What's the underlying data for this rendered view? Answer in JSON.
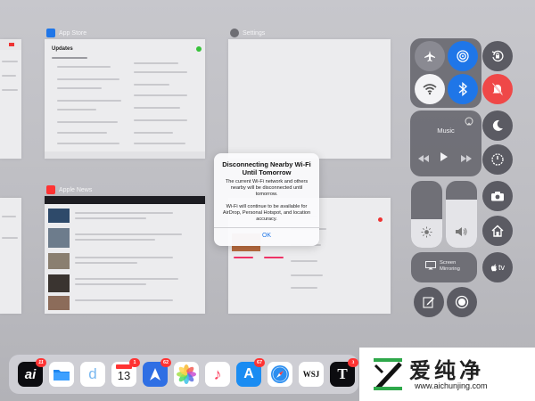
{
  "app_switcher": {
    "app_store_label": "App Store",
    "settings_label": "Settings",
    "news_label": "Apple News",
    "updates_title": "Updates"
  },
  "control_center": {
    "music_label": "Music",
    "screen_mirroring_label": "Screen Mirroring",
    "appletv_label": "tv"
  },
  "alert": {
    "title": "Disconnecting Nearby Wi-Fi Until Tomorrow",
    "message1": "The current Wi-Fi network and others nearby will be disconnected until tomorrow.",
    "message2": "Wi-Fi will continue to be available for AirDrop, Personal Hotspot, and location accuracy.",
    "ok": "OK"
  },
  "dock": {
    "apps": [
      {
        "name": "ai",
        "label": "ai",
        "badge": "11"
      },
      {
        "name": "files",
        "label": "",
        "badge": ""
      },
      {
        "name": "d-app",
        "label": "d",
        "badge": ""
      },
      {
        "name": "calendar",
        "label": "13",
        "badge": "1"
      },
      {
        "name": "spark",
        "label": "",
        "badge": "62"
      },
      {
        "name": "photos",
        "label": "",
        "badge": ""
      },
      {
        "name": "music",
        "label": "♪",
        "badge": ""
      },
      {
        "name": "appstore",
        "label": "A",
        "badge": "67"
      },
      {
        "name": "safari",
        "label": "",
        "badge": ""
      },
      {
        "name": "wsj",
        "label": "WSJ",
        "badge": ""
      },
      {
        "name": "nyt",
        "label": "T",
        "badge": "3"
      }
    ]
  },
  "watermark": {
    "text": "爱纯净",
    "url": "www.aichunjing.com"
  }
}
